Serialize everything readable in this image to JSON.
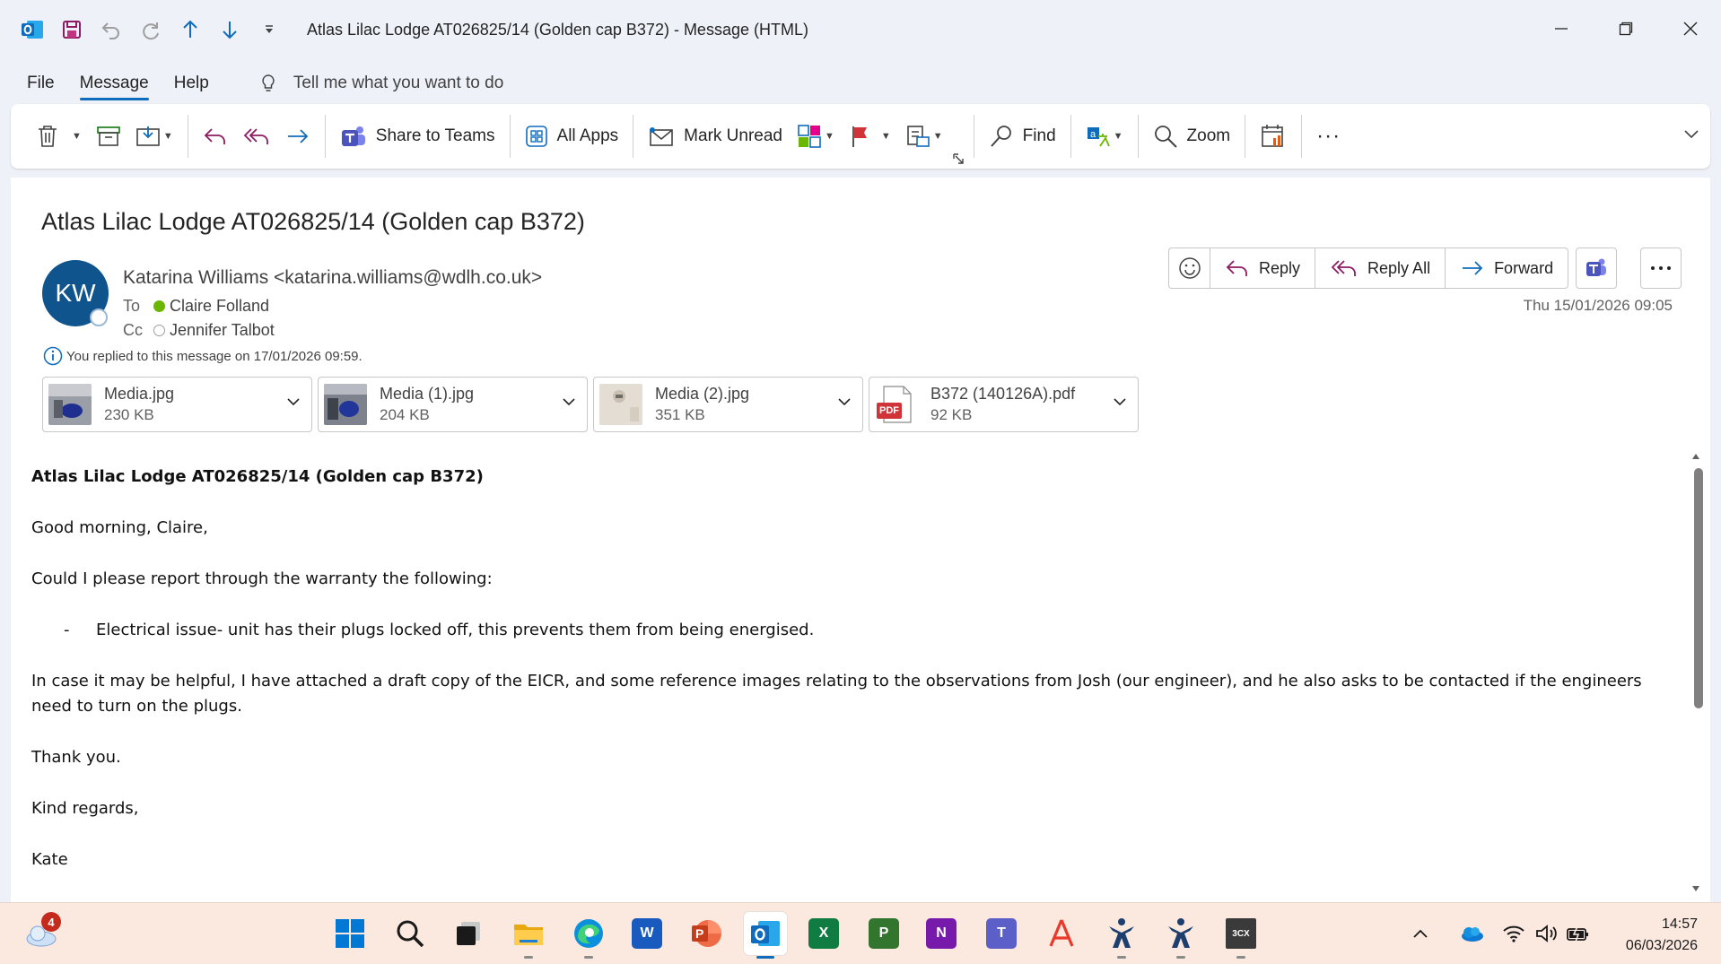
{
  "window": {
    "title": "Atlas Lilac Lodge AT026825/14 (Golden cap B372)  -  Message (HTML)"
  },
  "menu": {
    "file": "File",
    "message": "Message",
    "help": "Help",
    "tell_me": "Tell me what you want to do"
  },
  "ribbon": {
    "share_to_teams": "Share to Teams",
    "all_apps": "All Apps",
    "mark_unread": "Mark Unread",
    "find": "Find",
    "zoom": "Zoom",
    "more": "···"
  },
  "message": {
    "subject": "Atlas Lilac Lodge AT026825/14 (Golden cap B372)",
    "avatar_initials": "KW",
    "sender": "Katarina Williams <katarina.williams@wdlh.co.uk>",
    "to_label": "To",
    "to": "Claire Folland",
    "cc_label": "Cc",
    "cc": "Jennifer Talbot",
    "replied_info": "You replied to this message on 17/01/2026 09:59.",
    "received": "Thu 15/01/2026 09:05",
    "actions": {
      "reply": "Reply",
      "reply_all": "Reply All",
      "forward": "Forward"
    }
  },
  "attachments": [
    {
      "name": "Media.jpg",
      "size": "230 KB"
    },
    {
      "name": "Media (1).jpg",
      "size": "204 KB"
    },
    {
      "name": "Media (2).jpg",
      "size": "351 KB"
    },
    {
      "name": "B372 (140126A).pdf",
      "size": "92 KB",
      "badge": "PDF"
    }
  ],
  "body": {
    "heading": "Atlas Lilac Lodge AT026825/14 (Golden cap B372)",
    "greeting": "Good morning, Claire,",
    "line1": "Could I please report through the warranty the following:",
    "bullet_dash": "-",
    "bullet1": "Electrical issue- unit has their plugs locked off, this prevents them from being energised.",
    "para2": "In case it may be helpful, I have attached a draft copy of the EICR, and some reference images relating to the observations from Josh (our engineer), and he also asks to be contacted if the engineers need to turn on the plugs.",
    "thanks": "Thank you.",
    "regards": "Kind regards,",
    "signoff": "Kate"
  },
  "taskbar": {
    "weather_badge": "4",
    "apps": {
      "word": "W",
      "excel": "X",
      "project": "P",
      "onenote": "N",
      "teams": "T",
      "threecx": "3CX"
    },
    "time": "14:57",
    "date": "06/03/2026"
  },
  "colors": {
    "accent": "#0f6cbd",
    "avatar": "#0f548c",
    "taskbar": "#fbe9df",
    "available": "#6bb700"
  }
}
